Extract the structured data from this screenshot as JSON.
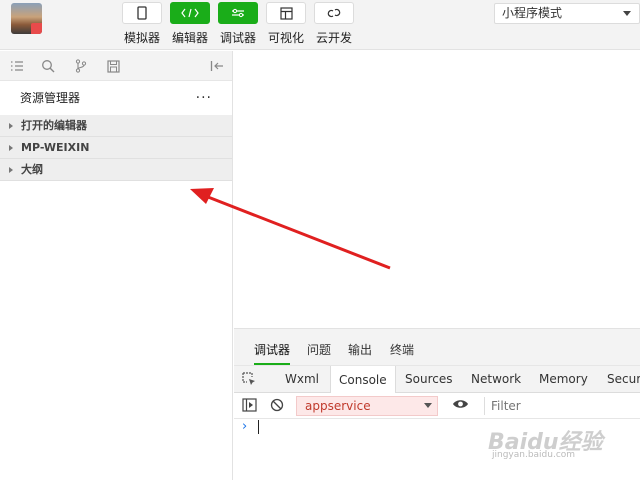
{
  "toolbar": {
    "buttons": [
      {
        "label": "模拟器",
        "icon": "phone-icon"
      },
      {
        "label": "编辑器",
        "icon": "code-icon"
      },
      {
        "label": "调试器",
        "icon": "debug-icon"
      },
      {
        "label": "可视化",
        "icon": "layout-icon"
      },
      {
        "label": "云开发",
        "icon": "cloud-link-icon"
      }
    ],
    "mode": "小程序模式"
  },
  "sidebar": {
    "explorer_title": "资源管理器",
    "more": "···",
    "sections": [
      "打开的编辑器",
      "MP-WEIXIN",
      "大纲"
    ]
  },
  "devtools": {
    "tabs": [
      "调试器",
      "问题",
      "输出",
      "终端"
    ],
    "panels": [
      "Wxml",
      "Console",
      "Sources",
      "Network",
      "Memory",
      "Securi"
    ],
    "context": "appservice",
    "filter_placeholder": "Filter",
    "prompt": "›"
  },
  "watermark": {
    "main": "Baidu经验",
    "sub": "jingyan.baidu.com"
  },
  "colors": {
    "accent": "#1aad19",
    "arrow": "#e02020",
    "context_bg": "#fde8e8"
  }
}
